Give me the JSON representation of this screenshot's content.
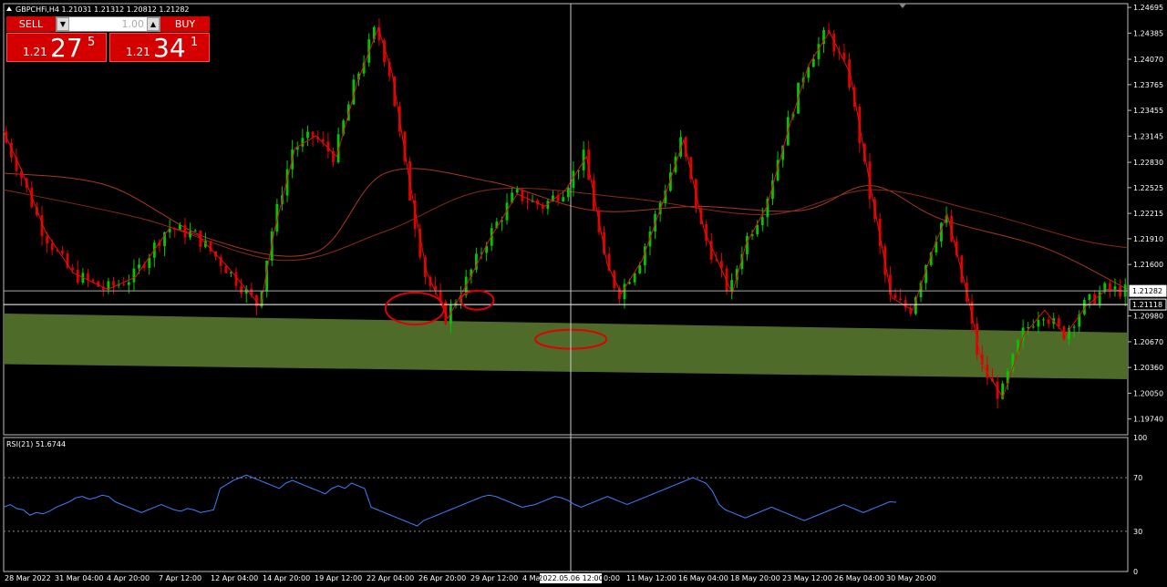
{
  "header": {
    "symbol_info": "GBPCHFi,H4  1.21031 1.21312 1.20812 1.21282"
  },
  "trade_panel": {
    "sell_label": "SELL",
    "buy_label": "BUY",
    "lot_value": "1.00",
    "sell_price_small": "1.21",
    "sell_price_big": "27",
    "sell_price_sup": "5",
    "buy_price_small": "1.21",
    "buy_price_big": "34",
    "buy_price_sup": "1"
  },
  "colors": {
    "background": "#000000",
    "bull": "#00c800",
    "bear": "#e00000",
    "zone": "#4e6b2a",
    "rsi_line": "#3f7fff",
    "price_tag": "#ffffff",
    "circle": "#e00000"
  },
  "rsi": {
    "label": "RSI(21) 51.6744"
  },
  "crosshair_time_label": "2022.05.06 12:00",
  "chart_data": [
    {
      "type": "candlestick",
      "symbol": "GBPCHFi",
      "timeframe": "H4",
      "ylim": [
        1.1955,
        1.2474
      ],
      "y_ticks": [
        "1.24695",
        "1.24385",
        "1.24070",
        "1.23765",
        "1.23455",
        "1.23145",
        "1.22830",
        "1.22525",
        "1.22215",
        "1.21910",
        "1.21600",
        "1.20980",
        "1.20670",
        "1.20360",
        "1.20050",
        "1.19740"
      ],
      "price_tags": [
        "1.21282",
        "1.21118"
      ],
      "x_ticks": [
        "28 Mar 2022",
        "31 Mar 04:00",
        "4 Apr 20:00",
        "7 Apr 12:00",
        "12 Apr 04:00",
        "14 Apr 20:00",
        "19 Apr 12:00",
        "22 Apr 04:00",
        "26 Apr 20:00",
        "29 Apr 12:00",
        "4 Ma",
        "0:00",
        "11 May 12:00",
        "16 May 04:00",
        "18 May 20:00",
        "23 May 12:00",
        "26 May 04:00",
        "30 May 20:00"
      ],
      "candle_count": 220,
      "path_points": [
        [
          0,
          1.232
        ],
        [
          5,
          1.2275
        ],
        [
          12,
          1.22
        ],
        [
          20,
          1.215
        ],
        [
          30,
          1.213
        ],
        [
          38,
          1.2145
        ],
        [
          48,
          1.2205
        ],
        [
          56,
          1.2195
        ],
        [
          64,
          1.216
        ],
        [
          70,
          1.213
        ],
        [
          74,
          1.211
        ],
        [
          78,
          1.22
        ],
        [
          84,
          1.23
        ],
        [
          90,
          1.2315
        ],
        [
          96,
          1.229
        ],
        [
          102,
          1.238
        ],
        [
          108,
          1.2445
        ],
        [
          112,
          1.239
        ],
        [
          117,
          1.226
        ],
        [
          122,
          1.215
        ],
        [
          128,
          1.2095
        ],
        [
          134,
          1.214
        ],
        [
          140,
          1.219
        ],
        [
          148,
          1.2245
        ],
        [
          156,
          1.223
        ],
        [
          162,
          1.225
        ],
        [
          168,
          1.229
        ],
        [
          174,
          1.216
        ],
        [
          178,
          1.2125
        ],
        [
          184,
          1.2165
        ],
        [
          190,
          1.2235
        ],
        [
          196,
          1.231
        ],
        [
          202,
          1.22
        ],
        [
          210,
          1.2125
        ],
        [
          214,
          1.2185
        ],
        [
          220,
          1.223
        ],
        [
          226,
          1.232
        ],
        [
          232,
          1.24
        ],
        [
          238,
          1.244
        ],
        [
          244,
          1.239
        ],
        [
          250,
          1.225
        ],
        [
          256,
          1.212
        ],
        [
          262,
          1.2105
        ],
        [
          268,
          1.218
        ],
        [
          272,
          1.222
        ],
        [
          278,
          1.212
        ],
        [
          282,
          1.204
        ],
        [
          288,
          1.2
        ],
        [
          294,
          1.2075
        ],
        [
          300,
          1.2105
        ],
        [
          306,
          1.2075
        ],
        [
          312,
          1.211
        ],
        [
          318,
          1.213
        ],
        [
          324,
          1.2128
        ]
      ],
      "moving_averages": [
        {
          "points": [
            [
              0,
              1.227
            ],
            [
              30,
              1.2255
            ],
            [
              60,
              1.219
            ],
            [
              90,
              1.2175
            ],
            [
              110,
              1.227
            ],
            [
              140,
              1.226
            ],
            [
              170,
              1.2225
            ],
            [
              200,
              1.223
            ],
            [
              230,
              1.2225
            ],
            [
              250,
              1.2255
            ],
            [
              270,
              1.2215
            ],
            [
              300,
              1.218
            ],
            [
              324,
              1.213
            ]
          ]
        },
        {
          "points": [
            [
              0,
              1.225
            ],
            [
              40,
              1.2215
            ],
            [
              80,
              1.2165
            ],
            [
              110,
              1.22
            ],
            [
              140,
              1.225
            ],
            [
              180,
              1.224
            ],
            [
              220,
              1.222
            ],
            [
              250,
              1.225
            ],
            [
              280,
              1.2225
            ],
            [
              310,
              1.219
            ],
            [
              324,
              1.218
            ]
          ]
        }
      ],
      "zone": {
        "upper": [
          1.2101,
          1.2078
        ],
        "lower": [
          1.204,
          1.2022
        ]
      }
    },
    {
      "type": "line",
      "title": "RSI(21) 51.6744",
      "ylim": [
        0,
        100
      ],
      "y_ticks": [
        "100",
        "70",
        "30",
        "0"
      ],
      "levels": [
        70,
        30
      ],
      "values": [
        48,
        50,
        47,
        46,
        42,
        44,
        43,
        45,
        48,
        50,
        52,
        55,
        56,
        54,
        55,
        57,
        56,
        52,
        50,
        48,
        46,
        44,
        46,
        48,
        50,
        48,
        46,
        45,
        47,
        46,
        44,
        45,
        46,
        62,
        65,
        68,
        70,
        72,
        70,
        68,
        66,
        64,
        62,
        66,
        68,
        66,
        64,
        62,
        60,
        58,
        62,
        64,
        62,
        66,
        64,
        62,
        48,
        46,
        44,
        42,
        40,
        38,
        36,
        34,
        38,
        40,
        42,
        44,
        46,
        48,
        50,
        52,
        54,
        56,
        57,
        56,
        54,
        52,
        50,
        48,
        49,
        50,
        52,
        54,
        56,
        55,
        53,
        50,
        48,
        50,
        52,
        54,
        56,
        54,
        52,
        50,
        52,
        54,
        56,
        58,
        60,
        62,
        64,
        66,
        68,
        70,
        68,
        66,
        60,
        50,
        46,
        44,
        42,
        40,
        42,
        44,
        46,
        48,
        46,
        44,
        42,
        40,
        38,
        40,
        42,
        44,
        46,
        48,
        50,
        48,
        46,
        44,
        46,
        48,
        50,
        52,
        51.67
      ]
    }
  ]
}
